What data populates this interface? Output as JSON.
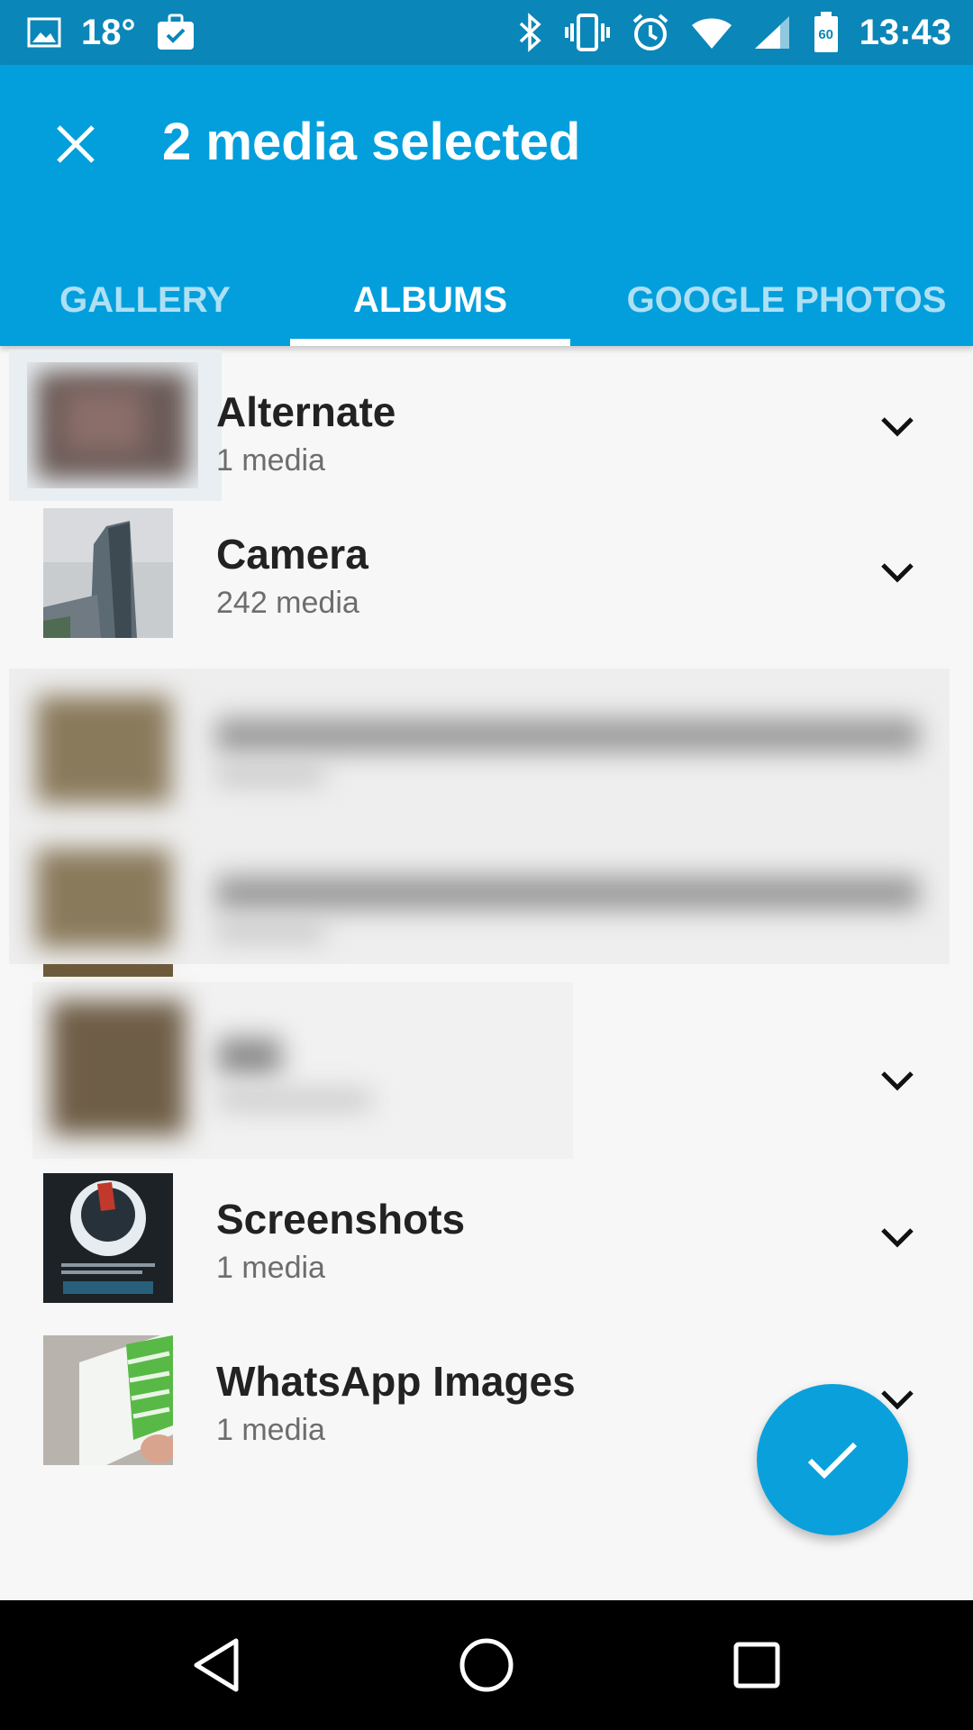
{
  "status_bar": {
    "temperature": "18°",
    "time": "13:43",
    "battery_level": "60"
  },
  "app_bar": {
    "title": "2 media selected"
  },
  "tabs": [
    {
      "label": "GALLERY",
      "active": false
    },
    {
      "label": "ALBUMS",
      "active": true
    },
    {
      "label": "GOOGLE PHOTOS",
      "active": false
    }
  ],
  "albums": [
    {
      "name": "Alternate",
      "count": "1 media"
    },
    {
      "name": "Camera",
      "count": "242 media"
    },
    {
      "name": "Screenshots",
      "count": "1 media"
    },
    {
      "name": "WhatsApp Images",
      "count": "1 media"
    }
  ],
  "colors": {
    "status_bar": "#0b86b8",
    "app_bar": "#039fdc",
    "fab": "#0aa0dc",
    "background": "#f7f7f7"
  },
  "icons": {
    "close": "close-icon",
    "expand": "chevron-down-icon",
    "confirm": "check-icon"
  }
}
